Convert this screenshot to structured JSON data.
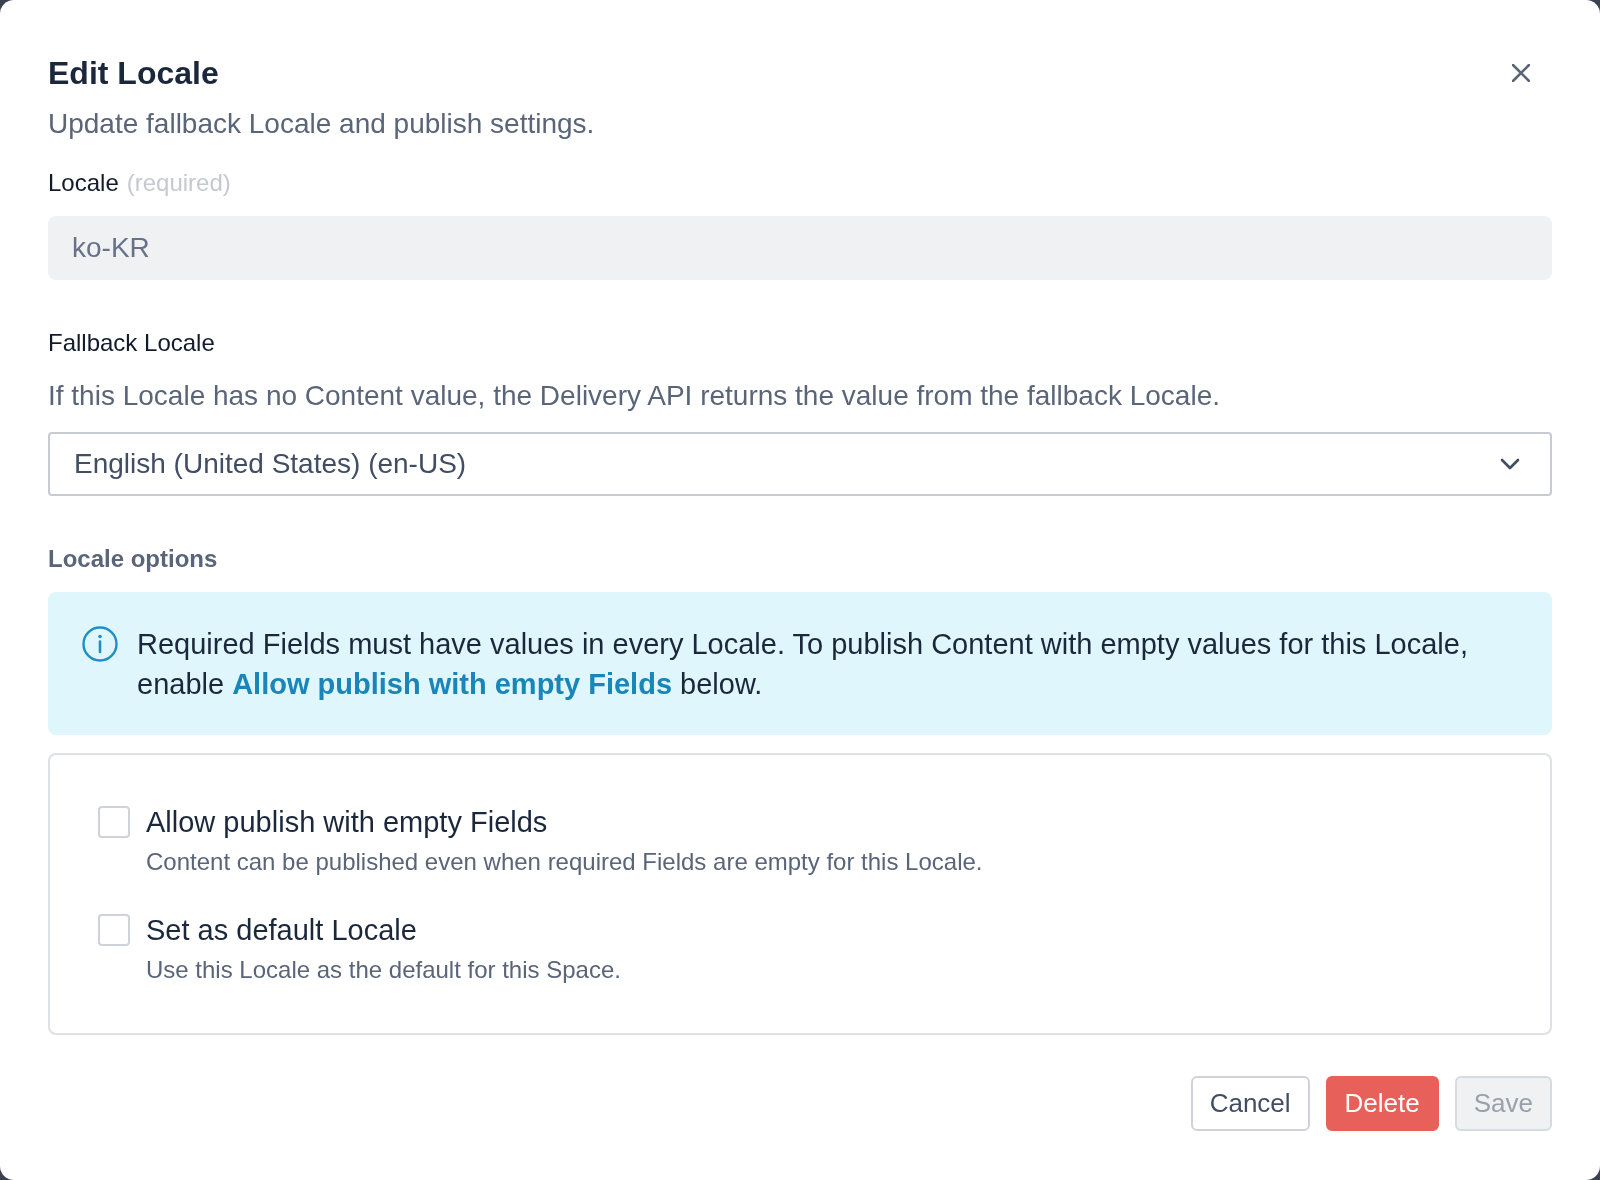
{
  "dialog": {
    "title": "Edit Locale",
    "subtitle": "Update fallback Locale and publish settings."
  },
  "locale_field": {
    "label": "Locale",
    "hint": "(required)",
    "value": "ko-KR",
    "disabled": true
  },
  "fallback_field": {
    "label": "Fallback Locale",
    "help": "If this Locale has no Content value, the Delivery API returns the value from the fallback Locale.",
    "value": "English (United States) (en-US)"
  },
  "locale_options": {
    "heading": "Locale options",
    "notice": "Required Fields must have values in every Locale. To publish Content with empty values for this Locale, enable **Allow publish with empty Fields** below.",
    "options": [
      {
        "label": "Allow publish with empty Fields",
        "description": "Content can be published even when required Fields are empty for this Locale.",
        "checked": false
      },
      {
        "label": "Set as default Locale",
        "description": "Use this Locale as the default for this Space.",
        "checked": false
      }
    ]
  },
  "buttons": [
    {
      "label": "Cancel",
      "kind": "secondary",
      "disabled": false
    },
    {
      "label": "Delete",
      "kind": "negative",
      "disabled": false
    },
    {
      "label": "Save",
      "kind": "primary",
      "disabled": true
    }
  ]
}
